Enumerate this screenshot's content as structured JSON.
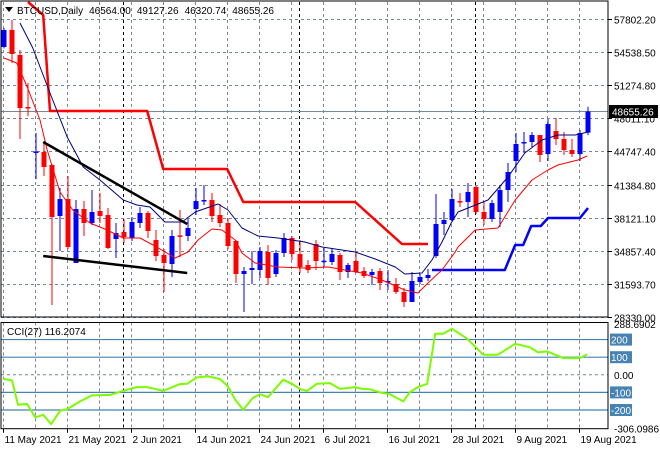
{
  "header": {
    "symbol_timeframe": "BTCUSD,Daily",
    "open": "46564.00",
    "high": "49127.26",
    "low": "46320.74",
    "close": "48655.26"
  },
  "price_axis": {
    "ticks": [
      "57802.20",
      "54538.50",
      "51274.80",
      "48011.10",
      "44747.40",
      "41384.80",
      "38121.10",
      "34857.40",
      "31593.70",
      "28330.00"
    ],
    "current_price": "48655.26"
  },
  "cci_panel": {
    "label": "CCI(27) 116.2074",
    "axis_labels": [
      {
        "text": "288.6902",
        "value": 288.6902,
        "boxed": false
      },
      {
        "text": "200",
        "value": 200,
        "boxed": true
      },
      {
        "text": "100",
        "value": 100,
        "boxed": true
      },
      {
        "text": "0.00",
        "value": 0,
        "boxed": false
      },
      {
        "text": "-100",
        "value": -100,
        "boxed": true
      },
      {
        "text": "-200",
        "value": -200,
        "boxed": true
      },
      {
        "text": "-306.0986",
        "value": -306.0986,
        "boxed": false
      }
    ],
    "levels": [
      200,
      100,
      -100,
      -200
    ]
  },
  "time_axis": {
    "labels": [
      {
        "text": "11 May 2021",
        "bar": 0
      },
      {
        "text": "21 May 2021",
        "bar": 8
      },
      {
        "text": "2 Jun 2021",
        "bar": 16
      },
      {
        "text": "14 Jun 2021",
        "bar": 24
      },
      {
        "text": "24 Jun 2021",
        "bar": 32
      },
      {
        "text": "6 Jul 2021",
        "bar": 40
      },
      {
        "text": "16 Jul 2021",
        "bar": 48
      },
      {
        "text": "28 Jul 2021",
        "bar": 56
      },
      {
        "text": "9 Aug 2021",
        "bar": 64
      },
      {
        "text": "19 Aug 2021",
        "bar": 72
      }
    ],
    "month_separators": [
      15,
      37,
      59
    ]
  },
  "colors": {
    "bull": "#0000ff",
    "bear": "#ff0000",
    "ma_blue": "#000080",
    "ma_red": "#ff0000",
    "stop_red": "#ff0000",
    "stop_blue": "#0000ff",
    "trendline": "#000000",
    "cci_line": "#7cfc00",
    "cci_level": "#4682b4",
    "grid": "#778899",
    "price_line": "#778899"
  },
  "chart_data": {
    "type": "candlestick",
    "title": "BTCUSD,Daily",
    "ylim": [
      28330,
      59484
    ],
    "ohlc": [
      [
        55032,
        56900,
        54900,
        56714
      ],
      [
        56714,
        57703,
        53450,
        54341
      ],
      [
        54242,
        54737,
        45934,
        48999
      ],
      [
        49100,
        51470,
        48200,
        49000
      ],
      [
        44600,
        46530,
        41980,
        44700
      ],
      [
        44648,
        45637,
        42275,
        43165
      ],
      [
        43363,
        43462,
        29517,
        38220
      ],
      [
        38319,
        41088,
        34857,
        39996
      ],
      [
        39996,
        42275,
        35055,
        35253
      ],
      [
        33671,
        39897,
        33671,
        39011
      ],
      [
        39011,
        39800,
        36341,
        37627
      ],
      [
        37627,
        40886,
        37429,
        38715
      ],
      [
        38814,
        40594,
        37627,
        38319
      ],
      [
        38418,
        39110,
        35055,
        35154
      ],
      [
        36044,
        37627,
        34164,
        36638
      ],
      [
        36737,
        38022,
        35648,
        36242
      ],
      [
        36143,
        38220,
        35846,
        37726
      ],
      [
        37627,
        39209,
        37133,
        38616
      ],
      [
        38616,
        38814,
        36143,
        36836
      ],
      [
        35945,
        36934,
        33868,
        34362
      ],
      [
        34461,
        35055,
        30803,
        33671
      ],
      [
        33572,
        36934,
        32286,
        36341
      ],
      [
        36400,
        38913,
        34263,
        36341
      ],
      [
        36341,
        38022,
        35846,
        37133
      ],
      [
        39011,
        41088,
        38418,
        39800
      ],
      [
        39800,
        41385,
        39400,
        39900
      ],
      [
        39900,
        40594,
        37726,
        38319
      ],
      [
        38418,
        39507,
        37232,
        37627
      ],
      [
        37627,
        38121,
        35055,
        35351
      ],
      [
        35846,
        35945,
        31692,
        32583
      ],
      [
        32583,
        33275,
        28825,
        32880
      ],
      [
        32979,
        34857,
        31593,
        33176
      ],
      [
        32979,
        35253,
        32187,
        34857
      ],
      [
        34758,
        35450,
        31494,
        32187
      ],
      [
        32583,
        34956,
        32286,
        34659
      ],
      [
        34659,
        36638,
        34263,
        36143
      ],
      [
        36143,
        36341,
        33967,
        34560
      ],
      [
        34560,
        35945,
        32682,
        33275
      ],
      [
        33473,
        33967,
        32682,
        32979
      ],
      [
        35549,
        35945,
        32979,
        33868
      ],
      [
        33800,
        35154,
        33275,
        33900
      ],
      [
        33770,
        35055,
        33473,
        34560
      ],
      [
        34461,
        34659,
        31990,
        32781
      ],
      [
        32781,
        33671,
        32187,
        33473
      ],
      [
        33868,
        34758,
        32682,
        32781
      ],
      [
        32880,
        33275,
        32187,
        32385
      ],
      [
        32484,
        33077,
        31494,
        32781
      ],
      [
        32880,
        33176,
        31000,
        31692
      ],
      [
        31791,
        32979,
        31000,
        31890
      ],
      [
        31593,
        32187,
        30605,
        30803
      ],
      [
        30803,
        31198,
        29319,
        29814
      ],
      [
        29814,
        32781,
        29814,
        31890
      ],
      [
        31791,
        32583,
        31593,
        32286
      ],
      [
        32187,
        33077,
        31890,
        32484
      ],
      [
        34362,
        40495,
        34164,
        37528
      ],
      [
        37528,
        38715,
        36440,
        37924
      ],
      [
        37924,
        40990,
        37825,
        39996
      ],
      [
        39800,
        40594,
        39209,
        39700
      ],
      [
        39700,
        41583,
        38220,
        40693
      ],
      [
        41187,
        41286,
        38516,
        38715
      ],
      [
        38715,
        39700,
        37430,
        38022
      ],
      [
        38022,
        39900,
        37726,
        39600
      ],
      [
        38715,
        41385,
        37232,
        40891
      ],
      [
        40891,
        43561,
        39700,
        42671
      ],
      [
        43759,
        46528,
        42671,
        45439
      ],
      [
        45538,
        46627,
        44549,
        45637
      ],
      [
        45637,
        46627,
        45142,
        46330
      ],
      [
        46330,
        46330,
        43660,
        44351
      ],
      [
        44450,
        47912,
        43759,
        47417
      ],
      [
        46725,
        48011,
        45340,
        45934
      ],
      [
        45934,
        46626,
        44351,
        44846
      ],
      [
        44846,
        45934,
        44153,
        44450
      ],
      [
        44450,
        46824,
        43759,
        46527
      ],
      [
        46564,
        49127.26,
        46320.74,
        48655.26
      ]
    ],
    "series": [
      {
        "name": "ma_blue",
        "points": [
          [
            2,
            57407
          ],
          [
            3.6,
            54934
          ],
          [
            5.75,
            50484
          ],
          [
            7.9,
            46132
          ],
          [
            9.9,
            43165
          ],
          [
            12,
            41879
          ],
          [
            14.9,
            39901
          ],
          [
            16.6,
            39407
          ],
          [
            18.25,
            39209
          ],
          [
            19.5,
            38220
          ],
          [
            20.1,
            37726
          ],
          [
            22.25,
            37726
          ],
          [
            23.9,
            38715
          ],
          [
            26.75,
            39506
          ],
          [
            28,
            38912
          ],
          [
            29.75,
            37132
          ],
          [
            31.75,
            36341
          ],
          [
            34.25,
            36143
          ],
          [
            37.6,
            35748
          ],
          [
            39.75,
            35253
          ],
          [
            43.9,
            34759
          ],
          [
            46.4,
            34066
          ],
          [
            48.9,
            33275
          ],
          [
            50.1,
            32583
          ],
          [
            52.25,
            32682
          ],
          [
            53.5,
            33967
          ],
          [
            54.75,
            35748
          ],
          [
            55.9,
            37627
          ],
          [
            56.75,
            38715
          ],
          [
            60.5,
            39901
          ],
          [
            63,
            42176
          ],
          [
            65.1,
            44550
          ],
          [
            67.25,
            45835
          ],
          [
            69.25,
            46330
          ],
          [
            71.4,
            46330
          ],
          [
            73,
            46627
          ]
        ]
      },
      {
        "name": "ma_red",
        "points": [
          [
            0,
            53945
          ],
          [
            1.6,
            53451
          ],
          [
            2.9,
            51077
          ],
          [
            4.5,
            47813
          ],
          [
            5.4,
            44846
          ],
          [
            7,
            40693
          ],
          [
            8.6,
            38912
          ],
          [
            10.75,
            37627
          ],
          [
            12.9,
            36934
          ],
          [
            14.9,
            36143
          ],
          [
            17,
            36143
          ],
          [
            19.1,
            35253
          ],
          [
            21.4,
            34165
          ],
          [
            23,
            34759
          ],
          [
            24.25,
            35945
          ],
          [
            26,
            37033
          ],
          [
            27.25,
            36934
          ],
          [
            28.9,
            35945
          ],
          [
            29.75,
            34660
          ],
          [
            31.4,
            33671
          ],
          [
            34.25,
            33275
          ],
          [
            37.6,
            33176
          ],
          [
            40.5,
            33275
          ],
          [
            44.75,
            32682
          ],
          [
            47.25,
            31989
          ],
          [
            50.1,
            31000
          ],
          [
            51.75,
            30704
          ],
          [
            53,
            31693
          ],
          [
            54.75,
            32978
          ],
          [
            56.4,
            34759
          ],
          [
            56.75,
            35253
          ],
          [
            58.9,
            36934
          ],
          [
            61.75,
            37132
          ],
          [
            63.9,
            39901
          ],
          [
            66,
            41879
          ],
          [
            68,
            42868
          ],
          [
            69.25,
            43363
          ],
          [
            71.75,
            43857
          ],
          [
            72.9,
            44253
          ]
        ]
      },
      {
        "name": "stop_red",
        "points": [
          [
            3,
            59484
          ],
          [
            4.9,
            58198
          ],
          [
            5.75,
            48703
          ],
          [
            17.9,
            48703
          ],
          [
            19.9,
            42967
          ],
          [
            27.9,
            42967
          ],
          [
            29.9,
            39704
          ],
          [
            43.9,
            39704
          ],
          [
            49.75,
            35550
          ],
          [
            53,
            35550
          ]
        ]
      },
      {
        "name": "stop_blue",
        "points": [
          [
            53.5,
            32979
          ],
          [
            62.6,
            32979
          ],
          [
            63.9,
            35451
          ],
          [
            64.9,
            35451
          ],
          [
            65.9,
            37330
          ],
          [
            67.1,
            37330
          ],
          [
            68,
            38121
          ],
          [
            72,
            38121
          ],
          [
            73,
            39110
          ]
        ]
      },
      {
        "name": "trendline_upper",
        "points": [
          [
            4.9,
            45638
          ],
          [
            22.9,
            37528
          ]
        ]
      },
      {
        "name": "trendline_lower",
        "points": [
          [
            4.9,
            34363
          ],
          [
            22.9,
            32682
          ]
        ]
      }
    ],
    "cci": {
      "period": 27,
      "ylim": [
        -306.0986,
        297
      ],
      "points": [
        [
          -0.1,
          -23
        ],
        [
          1,
          -32
        ],
        [
          1.75,
          -170
        ],
        [
          2.9,
          -166
        ],
        [
          3.9,
          -242
        ],
        [
          4.9,
          -227
        ],
        [
          5.9,
          -280
        ],
        [
          7,
          -205
        ],
        [
          7.9,
          -195
        ],
        [
          9.5,
          -151
        ],
        [
          11,
          -117
        ],
        [
          13.25,
          -114
        ],
        [
          14.9,
          -91
        ],
        [
          16.6,
          -70
        ],
        [
          17.9,
          -70
        ],
        [
          19.9,
          -91
        ],
        [
          22,
          -53
        ],
        [
          22.9,
          -51
        ],
        [
          24.1,
          -15
        ],
        [
          25.5,
          -9
        ],
        [
          27,
          -24
        ],
        [
          28,
          -66
        ],
        [
          28.9,
          -142
        ],
        [
          29.9,
          -199
        ],
        [
          31.1,
          -132
        ],
        [
          32,
          -110
        ],
        [
          33,
          -127
        ],
        [
          34.9,
          -28
        ],
        [
          36,
          -51
        ],
        [
          37,
          -81
        ],
        [
          37.9,
          -91
        ],
        [
          39.1,
          -51
        ],
        [
          40.75,
          -47
        ],
        [
          41.1,
          -57
        ],
        [
          42,
          -80
        ],
        [
          43.9,
          -70
        ],
        [
          44.75,
          -80
        ],
        [
          45.75,
          -82
        ],
        [
          47,
          -100
        ],
        [
          48.25,
          -110
        ],
        [
          49.9,
          -151
        ],
        [
          50.75,
          -98
        ],
        [
          51.75,
          -70
        ],
        [
          52.9,
          -51
        ],
        [
          53.9,
          233
        ],
        [
          54.9,
          233
        ],
        [
          56,
          261
        ],
        [
          57.9,
          205
        ],
        [
          59.9,
          114
        ],
        [
          61.75,
          114
        ],
        [
          63.9,
          176
        ],
        [
          65.75,
          156
        ],
        [
          66.75,
          127
        ],
        [
          67.9,
          133
        ],
        [
          69.9,
          95
        ],
        [
          72,
          95
        ],
        [
          72.9,
          116.2074
        ]
      ]
    }
  }
}
